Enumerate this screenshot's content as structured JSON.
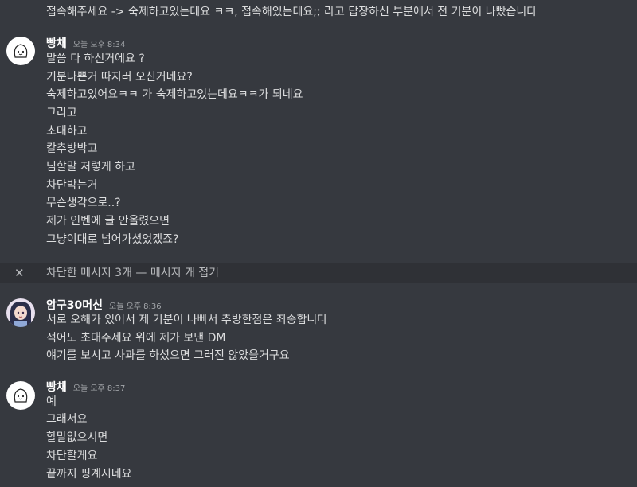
{
  "top_line": "접속해주세요 -> 숙제하고있는데요 ㅋㅋ, 접속해있는데요;; 라고 답장하신 부분에서 전 기분이 나빴습니다",
  "messages": [
    {
      "author": "빵채",
      "timestamp": "오늘 오후 8:34",
      "lines": [
        "말씀 다 하신거에요 ?",
        "기분나쁜거 따지러 오신거네요?",
        "숙제하고있어요ㅋㅋ 가 숙제하고있는데요ㅋㅋ가 되네요",
        "그리고",
        "초대하고",
        "칼추방박고",
        "님할말 저렇게 하고",
        "차단박는거",
        "무슨생각으로..?",
        "제가 인벤에 글 안올렸으면",
        "그냥이대로 넘어가셨었겠죠?"
      ]
    },
    {
      "author": "암구30머신",
      "timestamp": "오늘 오후 8:36",
      "lines": [
        "서로 오해가 있어서 제 기분이 나빠서 추방한점은 죄송합니다",
        "적어도 초대주세요 위에 제가 보낸 DM",
        "얘기를 보시고 사과를 하셨으면 그러진 않았을거구요"
      ]
    },
    {
      "author": "빵채",
      "timestamp": "오늘 오후 8:37",
      "lines": [
        "예",
        "그래서요",
        "할말없으시면",
        "차단할게요",
        "끝까지 핑계시네요"
      ]
    }
  ],
  "blocked_notice": {
    "text": "차단한 메시지 3개 — 메시지 개 접기",
    "icon": "close-icon"
  },
  "colors": {
    "background": "#36393f",
    "blocked_bar": "#2f3136",
    "text": "#dcddde",
    "author": "#ffffff",
    "timestamp": "#a3a6aa"
  }
}
